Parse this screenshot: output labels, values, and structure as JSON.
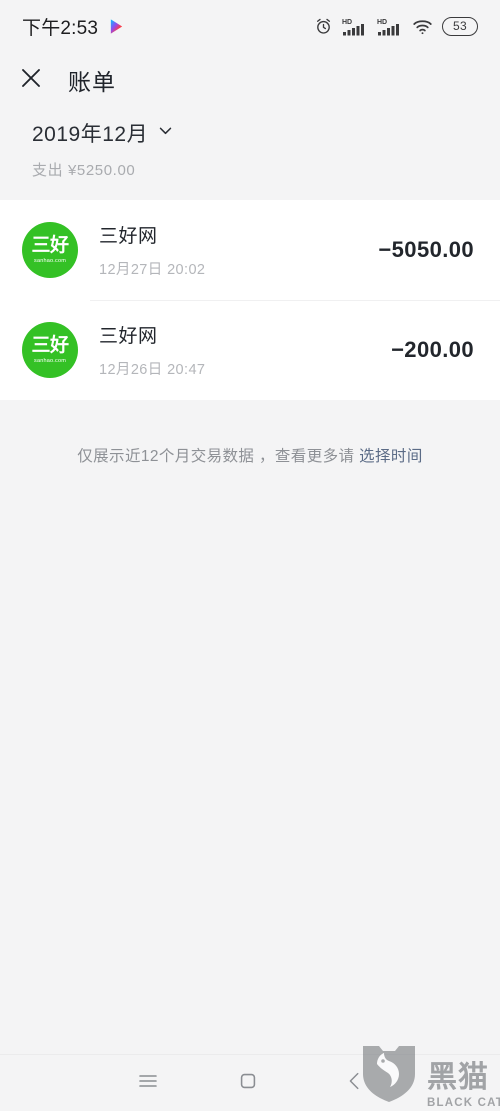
{
  "status_bar": {
    "time": "下午2:53",
    "play_icon": "google-play-icon",
    "alarm_icon": "alarm-clock-icon",
    "signal_1": {
      "icon": "signal-bars-icon",
      "label": "HD"
    },
    "signal_2": {
      "icon": "signal-bars-icon",
      "label": "HD"
    },
    "wifi_icon": "wifi-icon",
    "battery_level": "53"
  },
  "header": {
    "close_icon": "close-icon",
    "title": "账单"
  },
  "summary": {
    "month": "2019年12月",
    "chevron_icon": "chevron-down-icon",
    "expense_label": "支出 ¥5250.00"
  },
  "transactions": [
    {
      "avatar": {
        "main": "三好",
        "sub": "sanhao.com",
        "color": "#34c125"
      },
      "name": "三好网",
      "date": "12月27日 20:02",
      "amount": "−5050.00"
    },
    {
      "avatar": {
        "main": "三好",
        "sub": "sanhao.com",
        "color": "#34c125"
      },
      "name": "三好网",
      "date": "12月26日 20:47",
      "amount": "−200.00"
    }
  ],
  "footer_note": {
    "text": "仅展示近12个月交易数据 ，查看更多请",
    "link": "选择时间"
  },
  "nav_bar": {
    "menu_icon": "menu-icon",
    "home_icon": "home-square-icon",
    "back_icon": "back-chevron-icon"
  },
  "watermark": {
    "shield_icon": "black-cat-shield-icon",
    "cn": "黑猫",
    "en": "BLACK CAT"
  },
  "colors": {
    "background": "#f4f4f5",
    "card": "#ffffff",
    "brand_green": "#34c125",
    "text_primary": "#22262c",
    "text_muted": "#b4b6ba",
    "link": "#5b6b86"
  }
}
